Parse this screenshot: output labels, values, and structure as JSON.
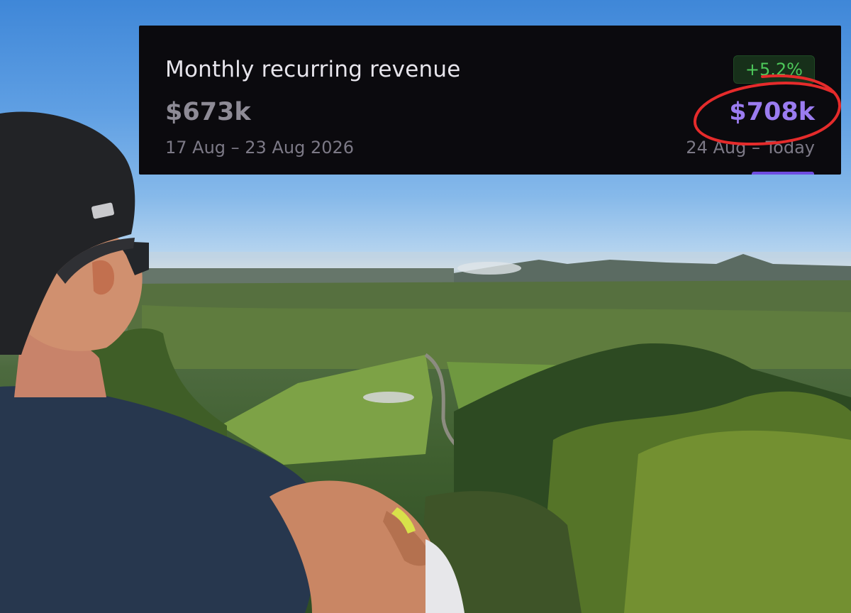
{
  "card": {
    "title": "Monthly recurring revenue",
    "previous": {
      "value": "$673k",
      "range": "17 Aug – 23 Aug 2026"
    },
    "current": {
      "change": "+5.2%",
      "value": "$708k",
      "range": "24 Aug – Today"
    }
  },
  "colors": {
    "card_background": "#0b0a0e",
    "current_value": "#9b7cf0",
    "change_positive": "#4dc85a",
    "annotation": "#e52b2b"
  },
  "annotation": {
    "shape": "hand-drawn ellipse around current value"
  }
}
